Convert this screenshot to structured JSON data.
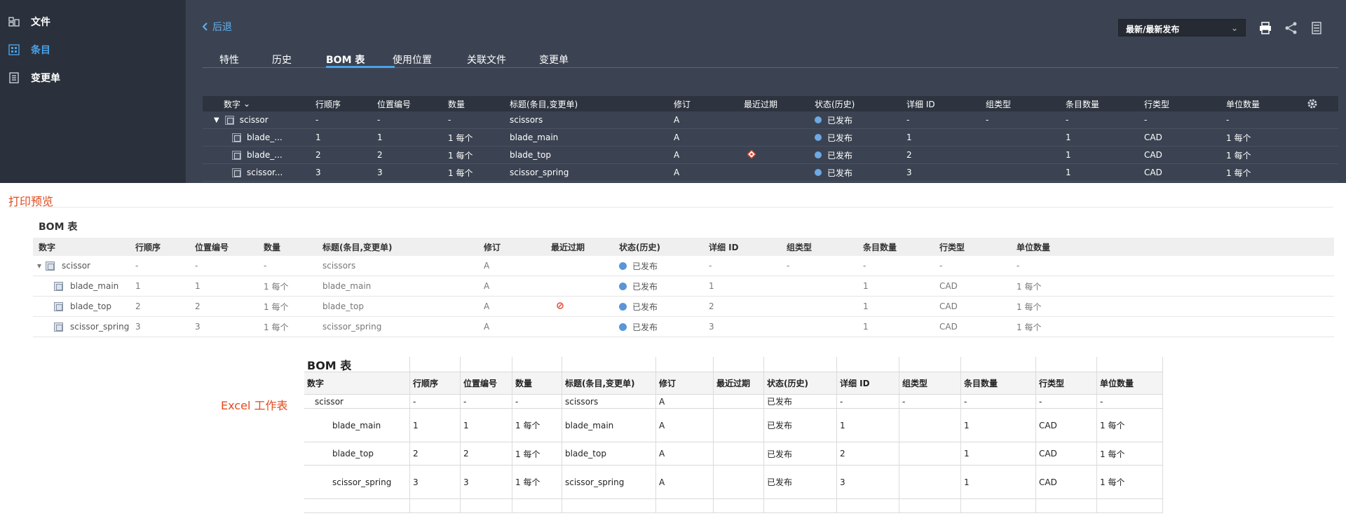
{
  "sidebar": {
    "items": [
      {
        "label": "文件",
        "icon": "files-icon"
      },
      {
        "label": "条目",
        "icon": "item-grid-icon",
        "active": true
      },
      {
        "label": "变更单",
        "icon": "change-order-icon"
      }
    ]
  },
  "header": {
    "back_label": "后退",
    "release_filter": "最新/最新发布",
    "print_tooltip": "打印"
  },
  "tabs": [
    "特性",
    "历史",
    "BOM 表",
    "使用位置",
    "关联文件",
    "变更单"
  ],
  "active_tab": "BOM 表",
  "columns": [
    "数字",
    "行顺序",
    "位置编号",
    "数量",
    "标题(条目,变更单)",
    "修订",
    "最近过期",
    "状态(历史)",
    "详细 ID",
    "组类型",
    "条目数量",
    "行类型",
    "单位数量"
  ],
  "bom_rows": [
    {
      "number": "scissor",
      "number_short": "scissor",
      "seq": "-",
      "pos": "-",
      "qty": "-",
      "title": "scissors",
      "rev": "A",
      "expired": false,
      "status": "已发布",
      "detail": "-",
      "group": "-",
      "count": "-",
      "rowtype": "-",
      "unit": "-",
      "level": 0
    },
    {
      "number": "blade_main",
      "number_short": "blade_...",
      "seq": "1",
      "pos": "1",
      "qty": "1 每个",
      "title": "blade_main",
      "rev": "A",
      "expired": false,
      "status": "已发布",
      "detail": "1",
      "group": "",
      "count": "1",
      "rowtype": "CAD",
      "unit": "1 每个",
      "level": 1
    },
    {
      "number": "blade_top",
      "number_short": "blade_...",
      "seq": "2",
      "pos": "2",
      "qty": "1 每个",
      "title": "blade_top",
      "rev": "A",
      "expired": true,
      "status": "已发布",
      "detail": "2",
      "group": "",
      "count": "1",
      "rowtype": "CAD",
      "unit": "1 每个",
      "level": 1
    },
    {
      "number": "scissor_spring",
      "number_short": "scissor...",
      "seq": "3",
      "pos": "3",
      "qty": "1 每个",
      "title": "scissor_spring",
      "rev": "A",
      "expired": false,
      "status": "已发布",
      "detail": "3",
      "group": "",
      "count": "1",
      "rowtype": "CAD",
      "unit": "1 每个",
      "level": 1
    }
  ],
  "print_preview": {
    "label": "打印预览",
    "title": "BOM 表"
  },
  "excel": {
    "label": "Excel 工作表",
    "title": "BOM 表"
  },
  "colors": {
    "accent": "#4aa3e8",
    "annotation": "#e24a1d",
    "dark_bg": "#3b4352",
    "sidebar_bg": "#2b313c",
    "status_dot": "#6da9e4",
    "expired_marker": "#e0452e"
  }
}
